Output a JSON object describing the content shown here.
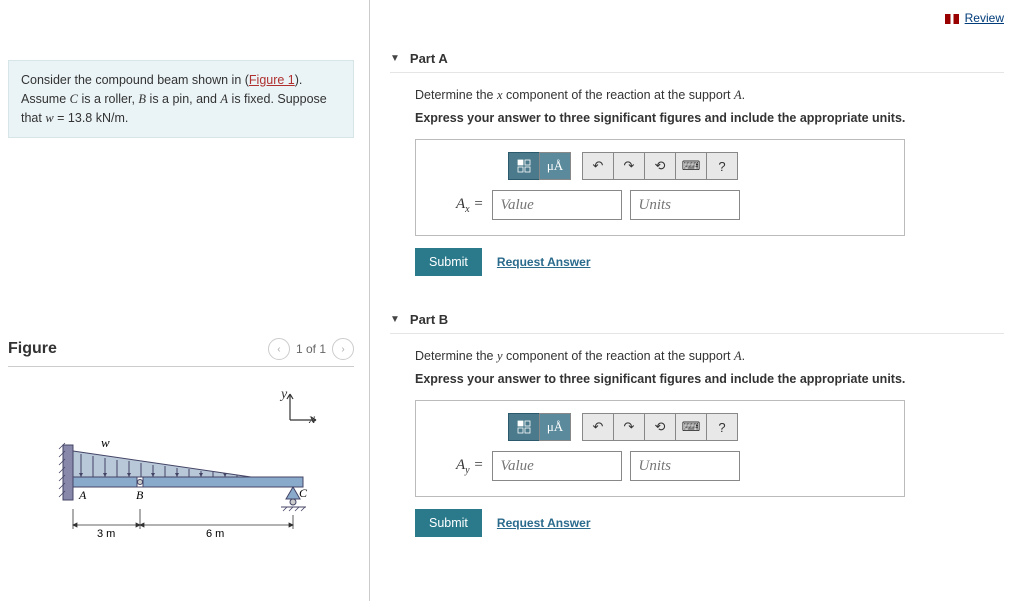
{
  "review_label": "Review",
  "problem": {
    "line1_pre": "Consider the compound beam shown in (",
    "figure_link": "Figure 1",
    "line1_post": ").",
    "line2": "Assume C is a roller, B is a pin, and A is fixed. Suppose that w = 13.8 kN/m."
  },
  "figure": {
    "title": "Figure",
    "counter": "1 of 1",
    "labels": {
      "y": "y",
      "x": "x",
      "w": "w",
      "A": "A",
      "B": "B",
      "C": "C",
      "d1": "3 m",
      "d2": "6 m"
    }
  },
  "partA": {
    "title": "Part A",
    "prompt": "Determine the x component of the reaction at the support A.",
    "instruct": "Express your answer to three significant figures and include the appropriate units.",
    "var": "A",
    "sub": "x",
    "value_ph": "Value",
    "units_ph": "Units",
    "submit": "Submit",
    "request": "Request Answer"
  },
  "partB": {
    "title": "Part B",
    "prompt": "Determine the y component of the reaction at the support A.",
    "instruct": "Express your answer to three significant figures and include the appropriate units.",
    "var": "A",
    "sub": "y",
    "value_ph": "Value",
    "units_ph": "Units",
    "submit": "Submit",
    "request": "Request Answer"
  },
  "toolbar": {
    "help": "?"
  }
}
